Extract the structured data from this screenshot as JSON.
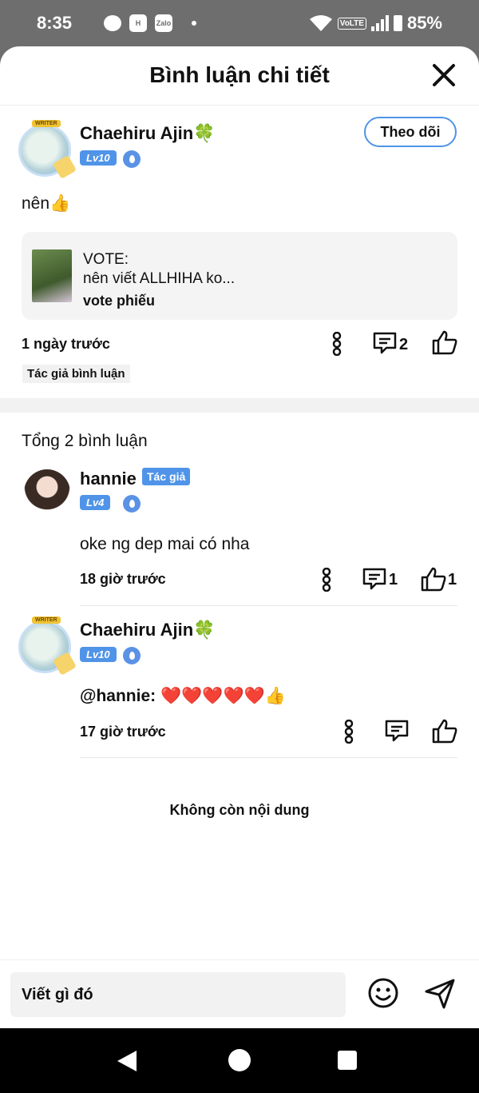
{
  "status_bar": {
    "time": "8:35",
    "app_icons": [
      "messenger-icon",
      "h-app-icon",
      "zalo-icon"
    ],
    "zalo_label": "Zalo",
    "network_label": "VoLTE",
    "battery": "85%"
  },
  "sheet": {
    "title": "Bình luận chi tiết"
  },
  "main_comment": {
    "username": "Chaehiru Ajin",
    "clover": "🍀",
    "level": "Lv10",
    "avatar_tag": "WRITER",
    "follow_label": "Theo dõi",
    "text": "nên👍",
    "vote_card": {
      "title": "VOTE:",
      "subtitle": "nên viết ALLHIHA ko...",
      "link": "vote phiếu"
    },
    "time": "1 ngày trước",
    "reply_count": "2",
    "author_label": "Tác giả bình luận"
  },
  "replies_header": "Tổng 2 bình luận",
  "replies": [
    {
      "username": "hannie",
      "author_tag": "Tác giả",
      "level": "Lv4",
      "text": "oke ng dep mai có nha",
      "time": "18 giờ trước",
      "reply_count": "1",
      "like_count": "1"
    },
    {
      "username": "Chaehiru Ajin",
      "clover": "🍀",
      "avatar_tag": "WRITER",
      "level": "Lv10",
      "mention": "@hannie:",
      "text": "❤️❤️❤️❤️❤️👍",
      "time": "17 giờ trước"
    }
  ],
  "end_text": "Không còn nội dung",
  "input": {
    "placeholder": "Viết gì đó"
  },
  "colors": {
    "accent": "#4f94e8",
    "status_bar": "#6e6e6e",
    "navbar": "#000000"
  }
}
